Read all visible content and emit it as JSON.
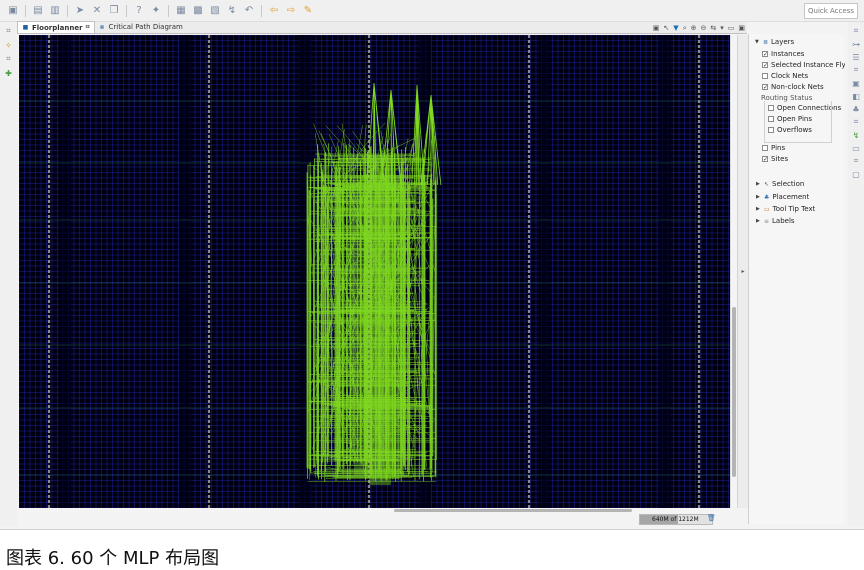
{
  "toolbar": {
    "icons": [
      "folder-icon",
      "save-icon",
      "print-icon",
      "run-icon",
      "delete-icon",
      "copy-icon",
      "help-icon",
      "debug-icon",
      "layout-icon",
      "grid-icon",
      "chip-icon",
      "route-icon",
      "undo-icon",
      "back-icon",
      "forward-icon",
      "pin-icon"
    ],
    "quick_access": "Quick Access"
  },
  "tabs": [
    {
      "label": "Floorplanner",
      "icon": "floorplan-icon",
      "active": true
    },
    {
      "label": "Critical Path Diagram",
      "icon": "path-icon",
      "active": false
    }
  ],
  "layers_panel": {
    "title": "Layers",
    "items": [
      {
        "label": "Instances",
        "checked": true
      },
      {
        "label": "Selected Instance Fly",
        "checked": true
      },
      {
        "label": "Clock Nets",
        "checked": false
      },
      {
        "label": "Non-clock Nets",
        "checked": true
      }
    ],
    "routing_status": {
      "label": "Routing Status",
      "items": [
        {
          "label": "Open Connections",
          "checked": false
        },
        {
          "label": "Open Pins",
          "checked": false
        },
        {
          "label": "Overflows",
          "checked": false
        }
      ]
    },
    "pins": {
      "label": "Pins",
      "checked": false
    },
    "sites": {
      "label": "Sites",
      "checked": true
    },
    "sections": [
      "Selection",
      "Placement",
      "Tool Tip Text",
      "Labels"
    ]
  },
  "status": {
    "memory": "640M of 1212M",
    "memory_used_fraction": 0.53
  },
  "caption": "图表 6. 60 个 MLP 布局图",
  "colors": {
    "canvas_bg": "#000010",
    "grid": "#2430c8",
    "net": "#7fd81f",
    "column": "#8a8a8a"
  }
}
